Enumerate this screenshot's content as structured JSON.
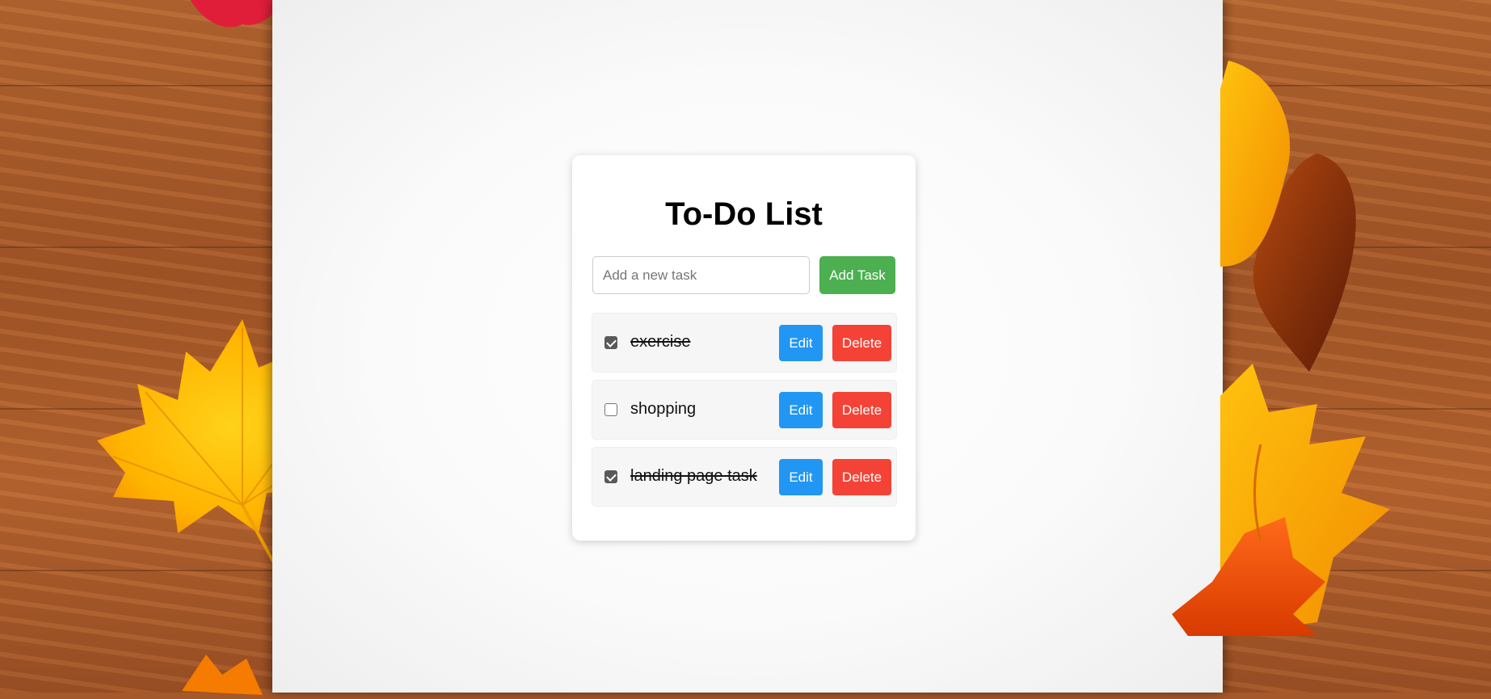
{
  "app": {
    "title": "To-Do List"
  },
  "input": {
    "placeholder": "Add a new task",
    "value": ""
  },
  "add_button": {
    "label": "Add Task"
  },
  "tasks": [
    {
      "text": "exercise",
      "completed": true,
      "edit_label": "Edit",
      "delete_label": "Delete"
    },
    {
      "text": "shopping",
      "completed": false,
      "edit_label": "Edit",
      "delete_label": "Delete"
    },
    {
      "text": "landing page task",
      "completed": true,
      "edit_label": "Edit",
      "delete_label": "Delete"
    }
  ],
  "colors": {
    "add": "#4caf50",
    "edit": "#2196f3",
    "delete": "#f44336"
  },
  "decorations": [
    "autumn-maple-leaf",
    "autumn-leaves-cluster",
    "wood-table-background"
  ]
}
